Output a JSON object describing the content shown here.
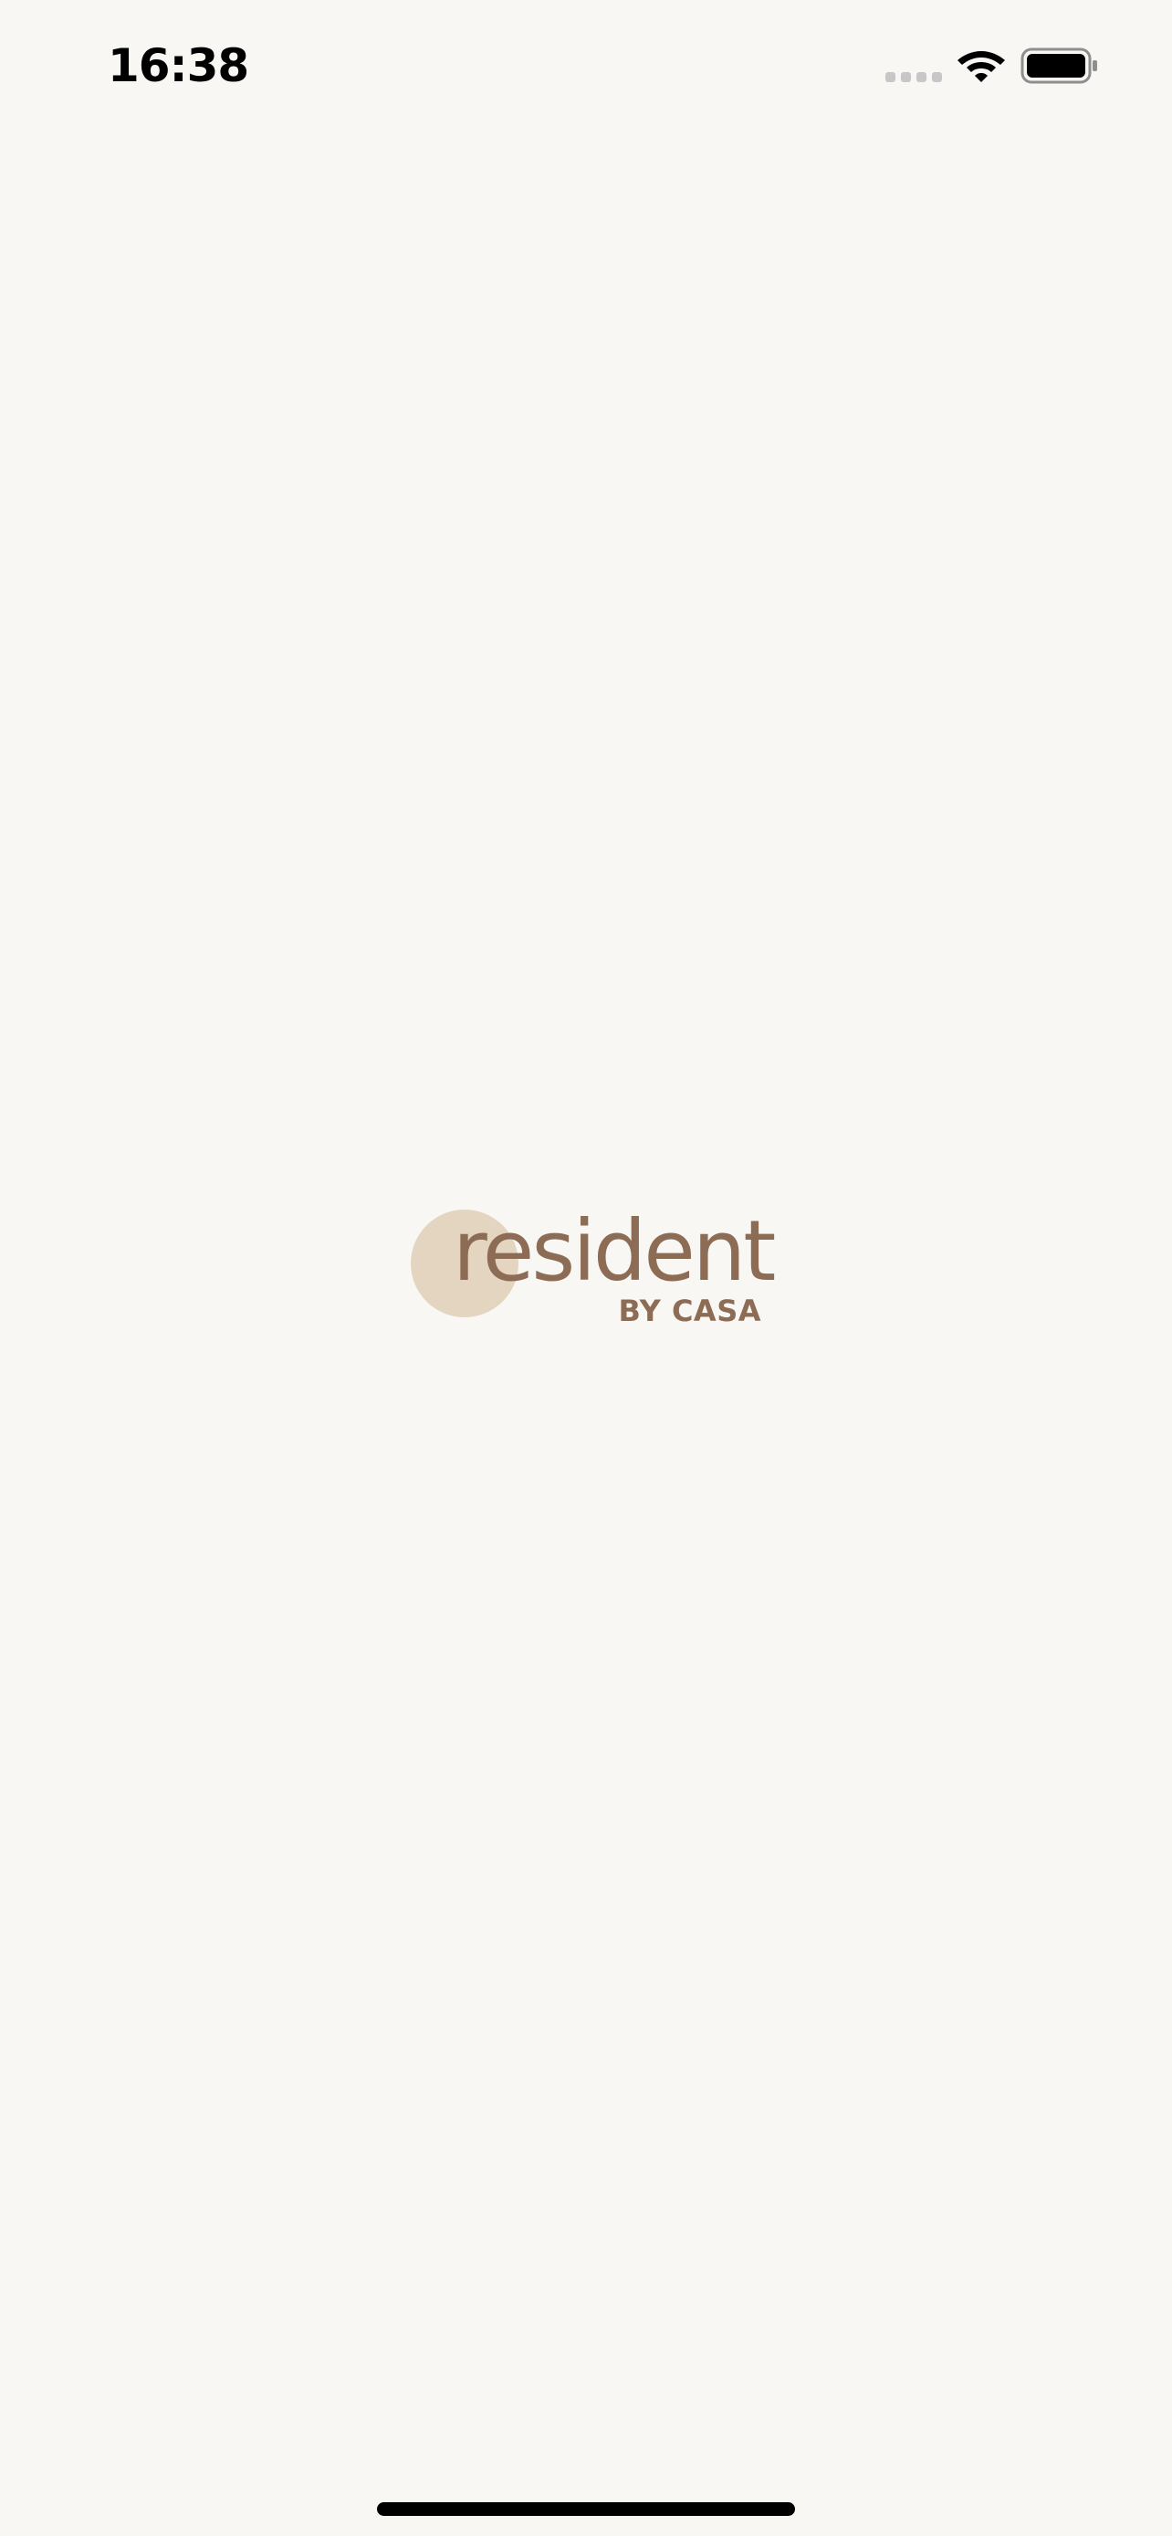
{
  "status_bar": {
    "time": "16:38",
    "icons": [
      "signal-dots-icon",
      "wifi-icon",
      "battery-icon"
    ]
  },
  "logo": {
    "wordmark": "resident",
    "tagline": "BY CASA"
  },
  "colors": {
    "background": "#f9f7f3",
    "brand_brown": "#8d6c55",
    "brand_circle": "#e4d5c1",
    "signal_inactive": "#c7c7c7"
  }
}
